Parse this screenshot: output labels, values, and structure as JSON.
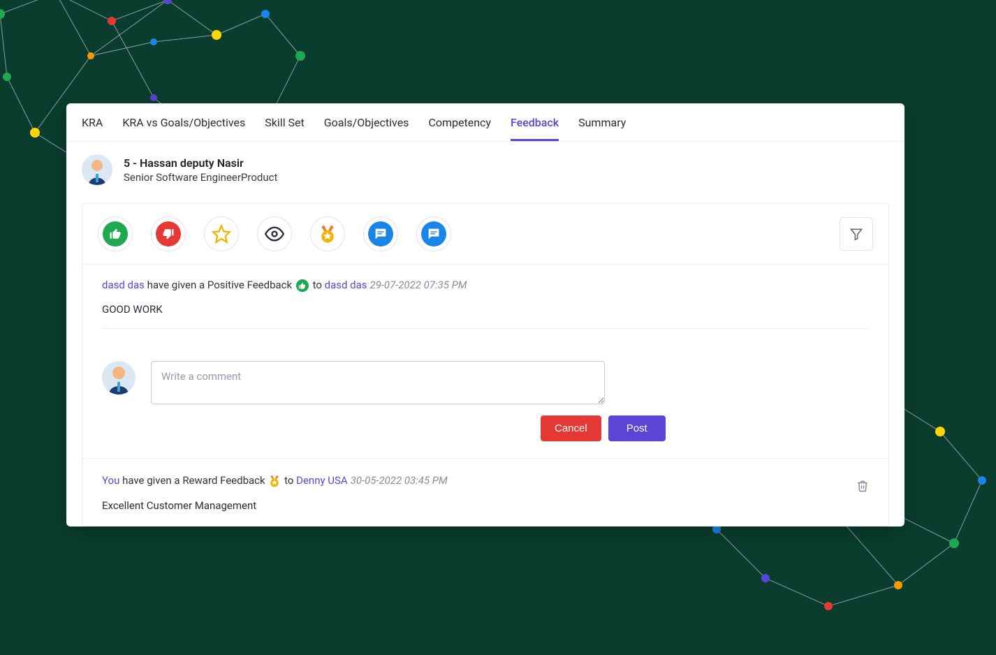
{
  "tabs": [
    "KRA",
    "KRA vs Goals/Objectives",
    "Skill Set",
    "Goals/Objectives",
    "Competency",
    "Feedback",
    "Summary"
  ],
  "active_tab_index": 5,
  "user": {
    "name": "5 - Hassan deputy Nasir",
    "title": "Senior Software EngineerProduct"
  },
  "actions": {
    "thumbs_up": "thumbs-up-icon",
    "thumbs_down": "thumbs-down-icon",
    "star": "star-icon",
    "watch": "eye-icon",
    "reward": "medal-icon",
    "chat1": "chat-icon",
    "chat2": "chat-icon"
  },
  "entry1": {
    "from": "dasd das",
    "action_text": " have given a Positive Feedback ",
    "to_label": " to ",
    "to": "dasd das",
    "timestamp": "29-07-2022 07:35 PM",
    "body": "GOOD WORK"
  },
  "comment": {
    "placeholder": "Write a comment",
    "cancel": "Cancel",
    "post": "Post"
  },
  "entry2": {
    "from": "You",
    "action_text": " have given a Reward Feedback ",
    "to_label": " to ",
    "to": "Denny USA",
    "timestamp": "30-05-2022 03:45 PM",
    "body": "Excellent Customer Management"
  }
}
